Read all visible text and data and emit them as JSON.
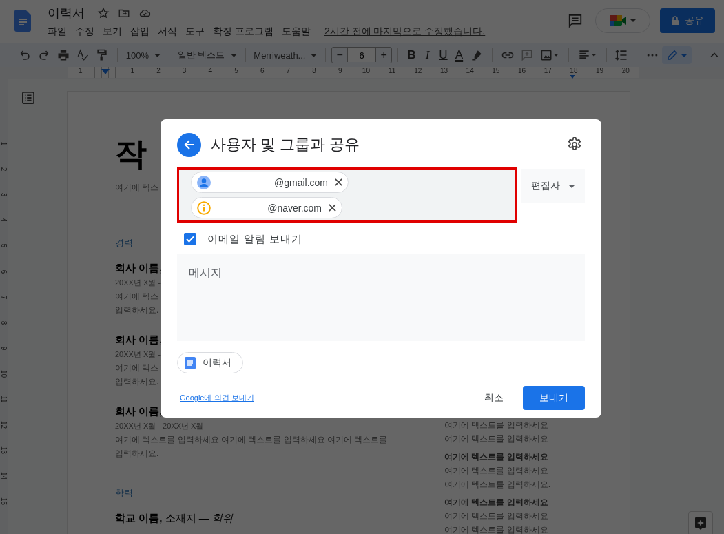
{
  "header": {
    "title": "이력서",
    "menus": [
      "파일",
      "수정",
      "보기",
      "삽입",
      "서식",
      "도구",
      "확장 프로그램",
      "도움말"
    ],
    "last_edit": "2시간 전에 마지막으로 수정했습니다.",
    "share_button": "공유"
  },
  "toolbar": {
    "zoom": "100%",
    "style": "일반 텍스트",
    "font": "Merriweath...",
    "font_size": "6",
    "decrease": "−",
    "increase": "+",
    "format_buttons": [
      "B",
      "I",
      "U",
      "A"
    ]
  },
  "ruler": {
    "numbers": [
      "1",
      "1",
      "2",
      "3",
      "4",
      "5",
      "6",
      "7",
      "8",
      "9",
      "10",
      "11",
      "12",
      "13",
      "14",
      "15",
      "16",
      "17",
      "18",
      "19",
      "20"
    ]
  },
  "vertical_ruler": {
    "numbers": [
      "1",
      "2",
      "3",
      "4",
      "5",
      "6",
      "7",
      "8",
      "9",
      "10",
      "11",
      "12",
      "13",
      "14",
      "15"
    ]
  },
  "document": {
    "left": [
      {
        "kind": "title",
        "text": "작"
      },
      {
        "kind": "body",
        "text": "여기에 텍스"
      },
      {
        "kind": "section",
        "text": "경력"
      },
      {
        "kind": "job",
        "text": "회사 이름,"
      },
      {
        "kind": "date",
        "text": "20XX년 X월 -"
      },
      {
        "kind": "body",
        "text": "여기에 텍스"
      },
      {
        "kind": "body",
        "text": "입력하세요."
      },
      {
        "kind": "job",
        "text": "회사 이름,"
      },
      {
        "kind": "date",
        "text": "20XX년 X월 -"
      },
      {
        "kind": "body",
        "text": "여기에 텍스"
      },
      {
        "kind": "body",
        "text": "입력하세요."
      },
      {
        "kind": "job",
        "text": "회사 이름,"
      },
      {
        "kind": "date",
        "text": "20XX년 X월 - 20XX년 X월"
      },
      {
        "kind": "body",
        "text": "여기에 텍스트를 입력하세요 여기에 텍스트를 입력하세요 여기에 텍스트를"
      },
      {
        "kind": "body",
        "text": "입력하세요."
      },
      {
        "kind": "section",
        "text": "학력"
      },
      {
        "kind": "job",
        "text": "**학교 이름,** 소재지 — *학위*"
      }
    ],
    "right": [
      {
        "kind": "body",
        "text": "여기에 텍스트를 입력하세요"
      },
      {
        "kind": "body",
        "text": "여기에 텍스트를 입력하세요"
      },
      {
        "kind": "bold",
        "text": "여기에 텍스트를 입력하세요"
      },
      {
        "kind": "body",
        "text": "여기에 텍스트를 입력하세요"
      },
      {
        "kind": "body",
        "text": "여기에 텍스트를 입력하세요."
      },
      {
        "kind": "bold",
        "text": "여기에 텍스트를 입력하세요"
      },
      {
        "kind": "body",
        "text": "여기에 텍스트를 입력하세요"
      },
      {
        "kind": "body",
        "text": "여기에 텍스트를 입력하세요"
      }
    ]
  },
  "dialog": {
    "title": "사용자 및 그룹과 공유",
    "recipients": [
      {
        "email": "@gmail.com",
        "kind": "person"
      },
      {
        "email": "@naver.com",
        "kind": "warning"
      }
    ],
    "role": "편집자",
    "notify": {
      "label": "이메일 알림 보내기",
      "checked": true
    },
    "message": {
      "placeholder": "메시지"
    },
    "attachment": "이력서",
    "feedback_link": "Google에 의견 보내기",
    "cancel": "취소",
    "send": "보내기"
  }
}
